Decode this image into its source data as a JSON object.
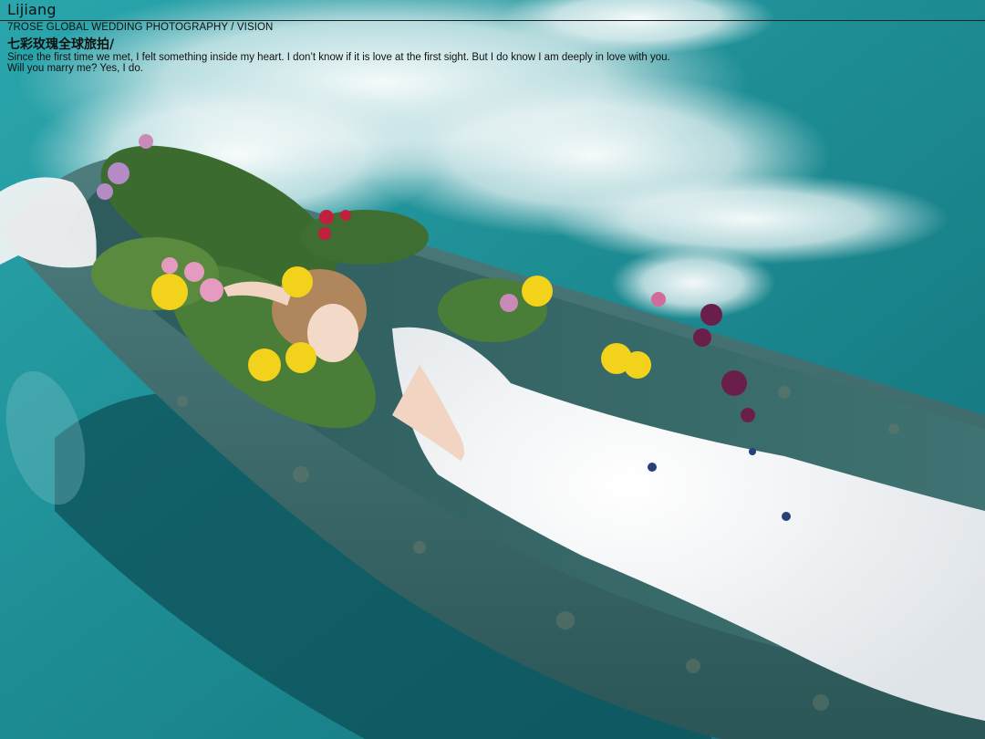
{
  "header": {
    "place": "Lijiang",
    "brand": "7ROSE  GLOBAL WEDDING PHOTOGRAPHY / VISION",
    "chinese_title": "七彩玫瑰全球旅拍/",
    "quote_line1": "Since the first time we met, I felt something inside my heart.  I don’t know if it is love at the first sight. But I do know I am deeply in love with you.",
    "quote_line2": "Will you marry me?   Yes, I do."
  },
  "colors": {
    "water": "#1f8e94",
    "boat": "#3d6a6c",
    "dress": "#f4f4f6",
    "flower_yellow": "#f2d21a",
    "flower_pink": "#e59ac0",
    "flower_red": "#c0203e",
    "flower_purple": "#6a1f4a"
  }
}
